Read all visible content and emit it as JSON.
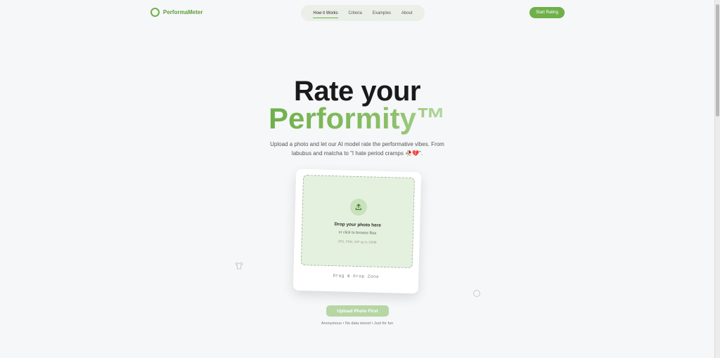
{
  "header": {
    "logo_text": "PerformaMeter",
    "nav": [
      {
        "label": "How it Works",
        "active": true
      },
      {
        "label": "Criteria",
        "active": false
      },
      {
        "label": "Examples",
        "active": false
      },
      {
        "label": "About",
        "active": false
      }
    ],
    "cta_label": "Start Rating"
  },
  "hero": {
    "title_line1": "Rate your",
    "title_line2": "Performity™",
    "subtitle_line1": "Upload a photo and let our AI model rate the performative vibes. From",
    "subtitle_line2": "labubus and matcha to \"I hate period cramps 🥀💔\"."
  },
  "upload": {
    "icon": "upload-icon",
    "title": "Drop your photo here",
    "subtitle": "or click to browse files",
    "formats": "JPG, PNG, GIF up to 10MB",
    "caption": "Drag & Drop Zone"
  },
  "submit_label": "Upload Photo First",
  "footnote": "Anonymous • No data stored • Just for fun",
  "colors": {
    "accent": "#6fb04a",
    "accent_light": "#b6d6a4",
    "dropzone_bg": "#e5f1df",
    "page_bg": "#f6f7f8"
  }
}
